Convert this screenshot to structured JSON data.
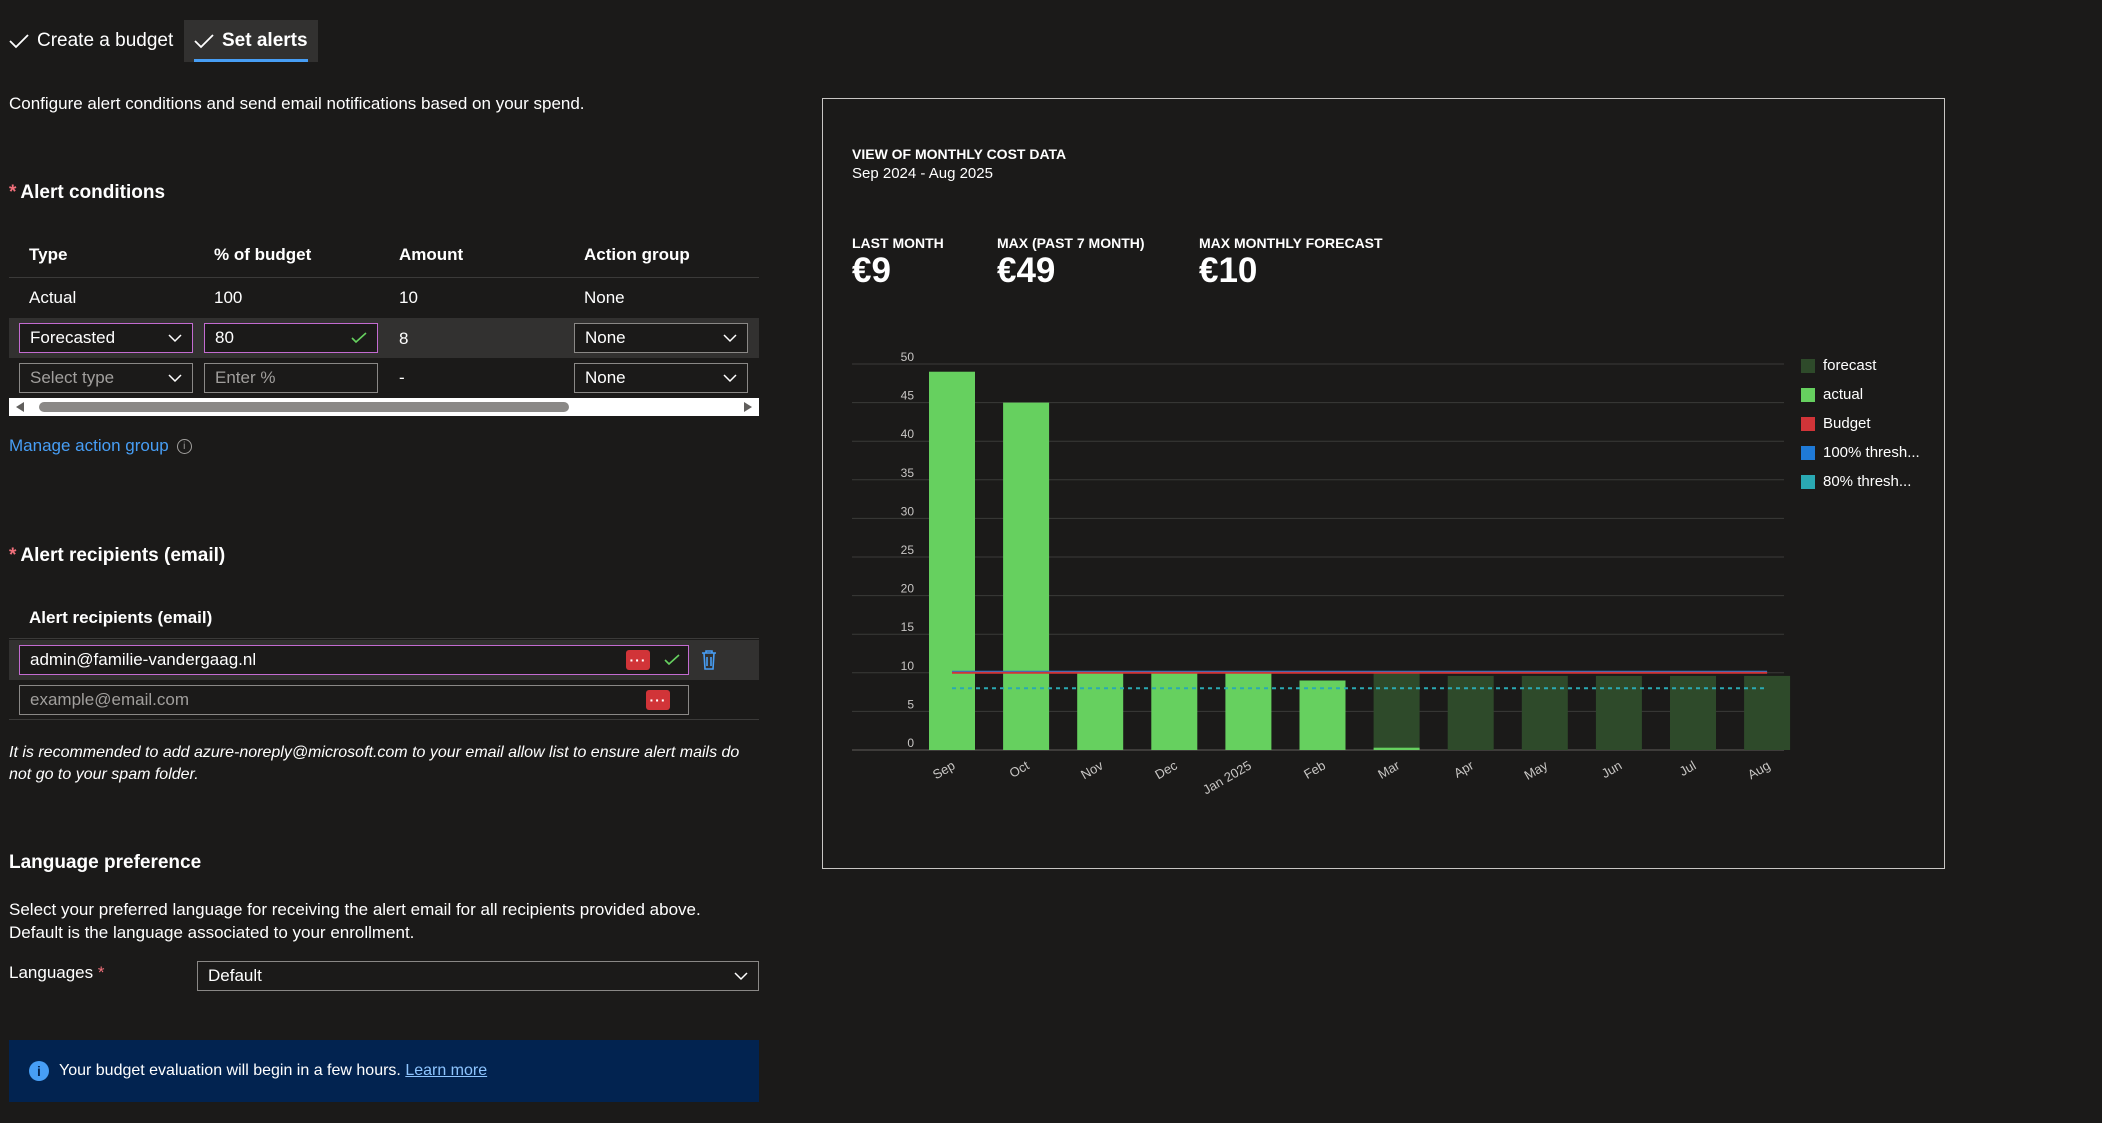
{
  "tabs": [
    {
      "label": "Create a budget",
      "active": false
    },
    {
      "label": "Set alerts",
      "active": true
    }
  ],
  "description": "Configure alert conditions and send email notifications based on your spend.",
  "alert_conditions": {
    "title": "Alert conditions",
    "headers": [
      "Type",
      "% of budget",
      "Amount",
      "Action group"
    ],
    "row1": {
      "type": "Actual",
      "percent": "100",
      "amount": "10",
      "action_group": "None"
    },
    "row2": {
      "type": "Forecasted",
      "percent": "80",
      "amount": "8",
      "action_group": "None"
    },
    "row3": {
      "type_placeholder": "Select type",
      "percent_placeholder": "Enter %",
      "amount": "-",
      "action_group": "None"
    },
    "manage_link": "Manage action group"
  },
  "recipients": {
    "title": "Alert recipients (email)",
    "column_header": "Alert recipients (email)",
    "email1": "admin@familie-vandergaag.nl",
    "email_placeholder": "example@email.com",
    "note": "It is recommended to add azure-noreply@microsoft.com to your email allow list to ensure alert mails do not go to your spam folder."
  },
  "language": {
    "title": "Language preference",
    "description": "Select your preferred language for receiving the alert email for all recipients provided above. Default is the language associated to your enrollment.",
    "label": "Languages",
    "value": "Default"
  },
  "banner": {
    "text": "Your budget evaluation will begin in a few hours.",
    "link": "Learn more"
  },
  "chart_panel": {
    "title": "VIEW OF MONTHLY COST DATA",
    "period": "Sep 2024 - Aug 2025",
    "kpis": [
      {
        "label": "LAST MONTH",
        "value": "€9"
      },
      {
        "label": "MAX (PAST 7 MONTH)",
        "value": "€49"
      },
      {
        "label": "MAX MONTHLY FORECAST",
        "value": "€10"
      }
    ]
  },
  "chart_data": {
    "type": "bar",
    "categories": [
      "Sep",
      "Oct",
      "Nov",
      "Dec",
      "Jan 2025",
      "Feb",
      "Mar",
      "Apr",
      "May",
      "Jun",
      "Jul",
      "Aug"
    ],
    "series": [
      {
        "name": "forecast",
        "color": "#2e4a2a",
        "values": [
          0,
          0,
          0,
          0,
          0,
          0,
          10,
          9.6,
          9.6,
          9.6,
          9.6,
          9.6
        ]
      },
      {
        "name": "actual",
        "color": "#66d05f",
        "values": [
          49,
          45,
          10,
          10,
          10,
          9,
          0.3,
          0,
          0,
          0,
          0,
          0
        ]
      }
    ],
    "lines": [
      {
        "name": "Budget",
        "color": "#d13438",
        "value": 10
      },
      {
        "name": "100% thresh...",
        "color": "#1f7ad7",
        "value": 10
      },
      {
        "name": "80% thresh...",
        "color": "#2aa9b3",
        "value": 8
      }
    ],
    "yticks": [
      0,
      5,
      10,
      15,
      20,
      25,
      30,
      35,
      40,
      45,
      50
    ],
    "ylim": [
      0,
      50
    ],
    "legend_position": "right"
  }
}
